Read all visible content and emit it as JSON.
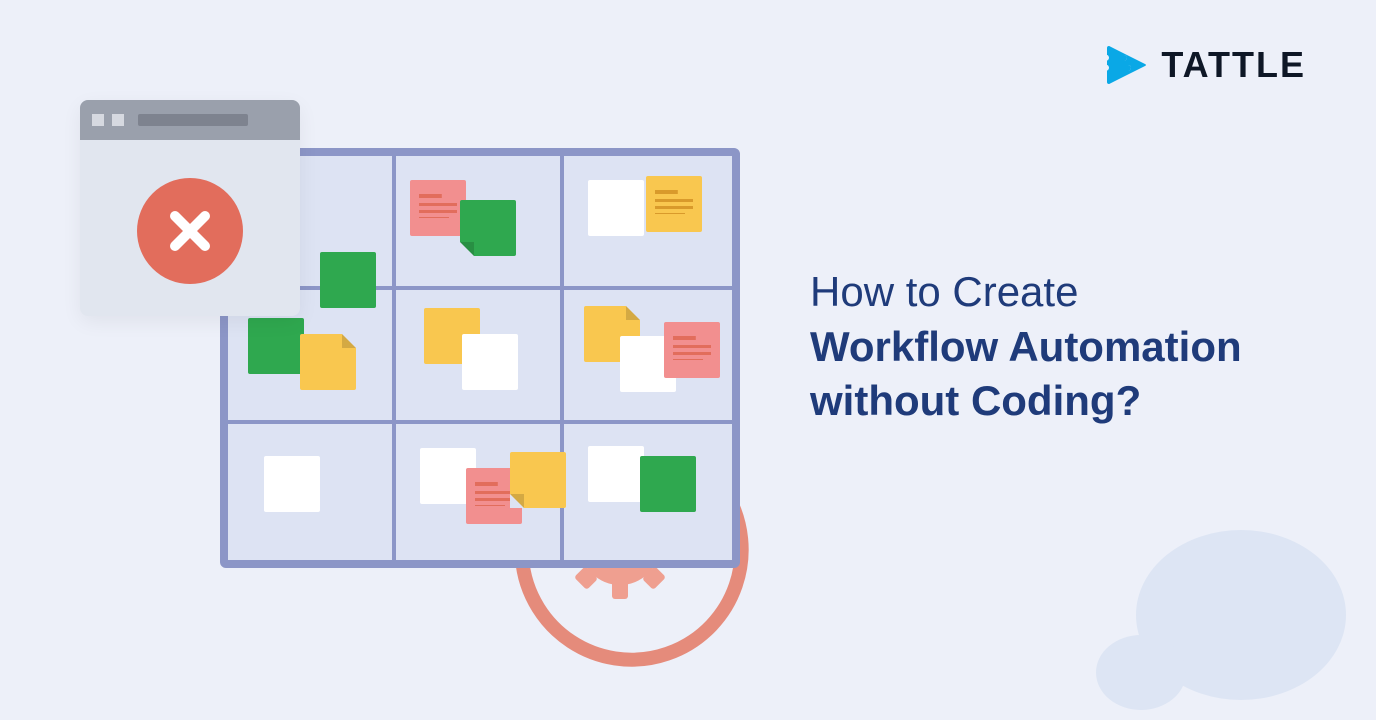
{
  "brand": {
    "name": "TATTLE"
  },
  "headline": {
    "line1": "How to Create",
    "line2": "Workflow Automation",
    "line3": "without Coding?"
  },
  "colors": {
    "background": "#edf0f9",
    "textPrimary": "#1f3b7a",
    "accentRed": "#e26d5c",
    "accentBlue": "#0aa8e6",
    "boardBorder": "#8c96c7",
    "boardFill": "#dde3f3",
    "noteGreen": "#2fa84f",
    "noteYellow": "#f9c74f",
    "notePink": "#f28f8f",
    "noteWhite": "#ffffff",
    "dialogGray": "#9aa0ac"
  },
  "icons": {
    "logo": "play-stripes-icon",
    "close": "close-x-icon",
    "gearLoop": "gear-cycle-icon"
  }
}
